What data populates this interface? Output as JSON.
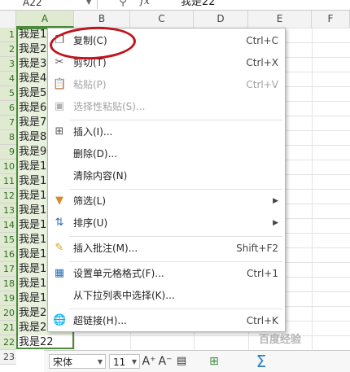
{
  "formula_bar": {
    "name_box": "A22",
    "fx_label": "fx",
    "value": "我是22",
    "search_icon": "magnifier-icon"
  },
  "columns": [
    "A",
    "B",
    "C",
    "D",
    "E",
    "F"
  ],
  "rows": [
    "1",
    "2",
    "3",
    "4",
    "5",
    "6",
    "7",
    "8",
    "9",
    "10",
    "11",
    "12",
    "13",
    "14",
    "15",
    "16",
    "17",
    "18",
    "19",
    "20",
    "21",
    "22",
    "23"
  ],
  "column_a_visible": [
    "我是1",
    "我是2",
    "我是3",
    "我是4",
    "我是5",
    "我是6",
    "我是7",
    "我是8",
    "我是9",
    "我是1",
    "我是1",
    "我是1",
    "我是1",
    "我是1",
    "我是1",
    "我是1",
    "我是1",
    "我是1",
    "我是1",
    "我是2",
    "我是2",
    "我是22"
  ],
  "context_menu": {
    "items": [
      {
        "label": "复制(C)",
        "shortcut": "Ctrl+C",
        "icon": "copy-icon",
        "enabled": true
      },
      {
        "label": "剪切(T)",
        "shortcut": "Ctrl+X",
        "icon": "scissors-icon",
        "enabled": true
      },
      {
        "label": "粘贴(P)",
        "shortcut": "Ctrl+V",
        "icon": "paste-icon",
        "enabled": false
      },
      {
        "label": "选择性粘贴(S)...",
        "shortcut": "",
        "icon": "paste-special-icon",
        "enabled": false
      },
      {
        "label": "插入(I)...",
        "shortcut": "",
        "icon": "insert-icon",
        "enabled": true
      },
      {
        "label": "删除(D)...",
        "shortcut": "",
        "icon": "",
        "enabled": true
      },
      {
        "label": "清除内容(N)",
        "shortcut": "",
        "icon": "",
        "enabled": true
      },
      {
        "label": "筛选(L)",
        "shortcut": "",
        "icon": "filter-icon",
        "enabled": true,
        "submenu": true
      },
      {
        "label": "排序(U)",
        "shortcut": "",
        "icon": "sort-icon",
        "enabled": true,
        "submenu": true
      },
      {
        "label": "插入批注(M)...",
        "shortcut": "Shift+F2",
        "icon": "comment-icon",
        "enabled": true
      },
      {
        "label": "设置单元格格式(F)...",
        "shortcut": "Ctrl+1",
        "icon": "format-cells-icon",
        "enabled": true
      },
      {
        "label": "从下拉列表中选择(K)...",
        "shortcut": "",
        "icon": "",
        "enabled": true
      },
      {
        "label": "超链接(H)...",
        "shortcut": "Ctrl+K",
        "icon": "hyperlink-icon",
        "enabled": true
      }
    ]
  },
  "mini_toolbar": {
    "font_name": "宋体",
    "font_size": "11",
    "grow_font": "A⁺",
    "shrink_font": "A⁻"
  },
  "watermark": "百度经验",
  "highlight_color": "#c0131b",
  "selection_color": "#4a8a3a"
}
